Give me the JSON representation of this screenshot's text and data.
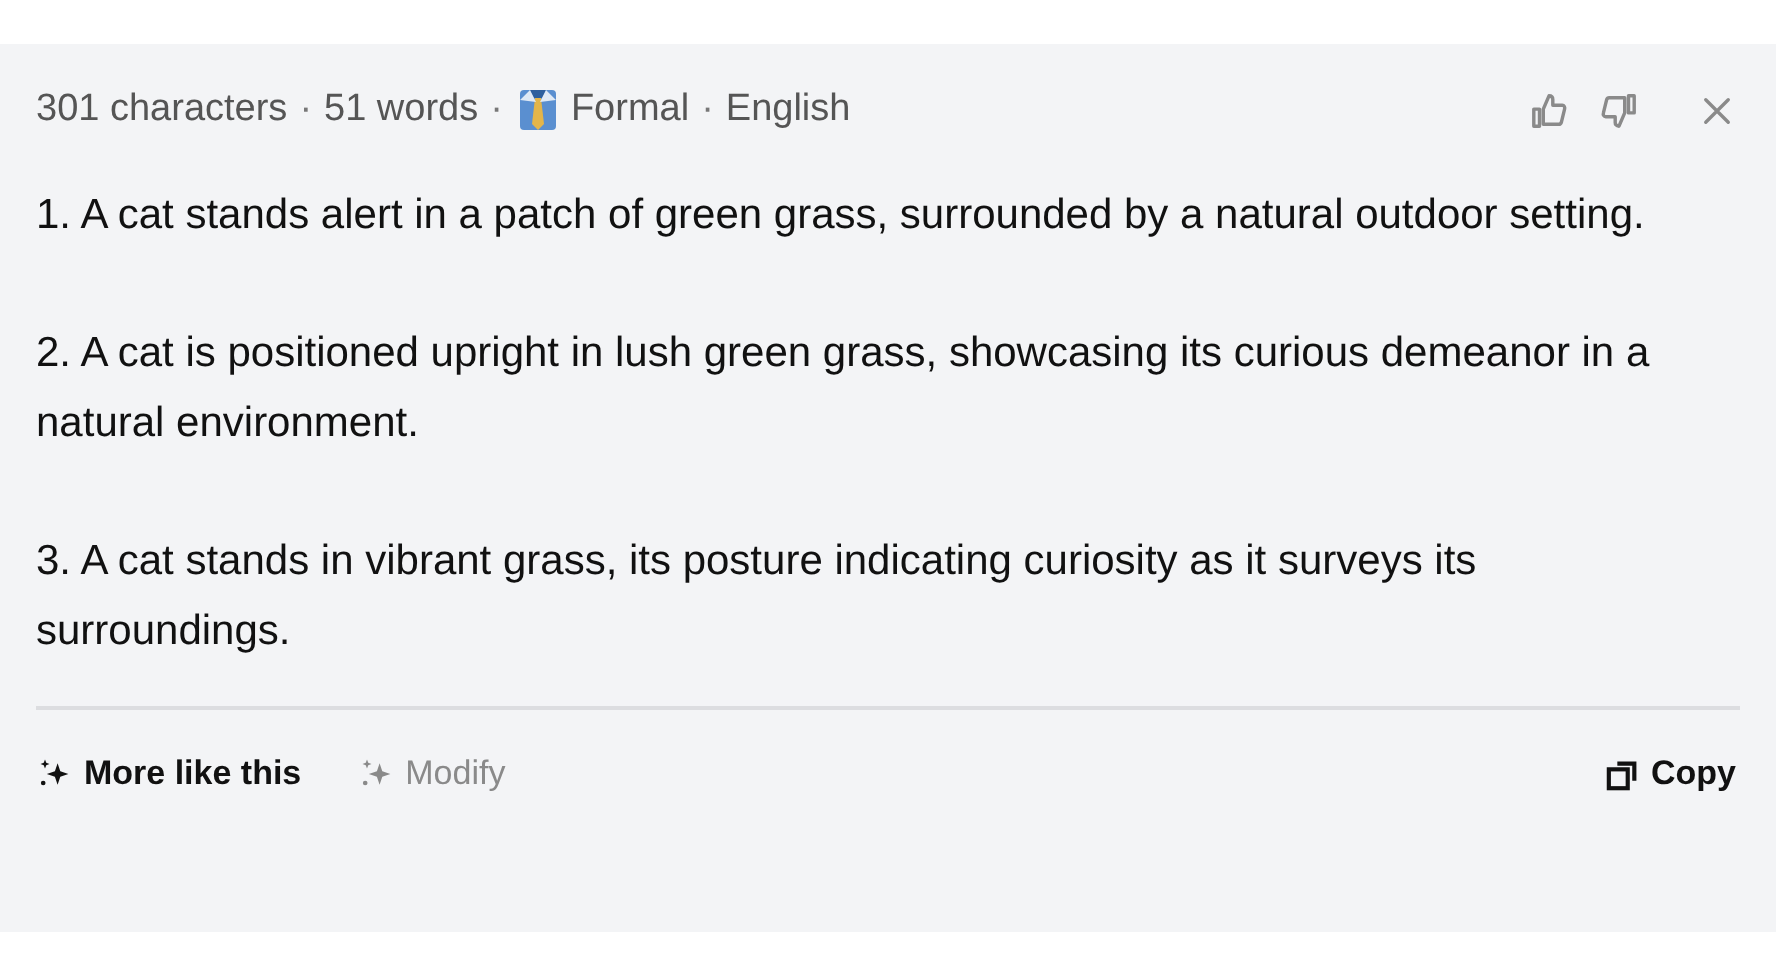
{
  "meta": {
    "characters": "301 characters",
    "sep_1": "·",
    "words": "51 words",
    "sep_2": "·",
    "tone": "Formal",
    "sep_3": "·",
    "language": "English"
  },
  "items": [
    "1. A cat stands alert in a patch of green grass, surrounded by a natural outdoor setting.",
    "2. A cat is positioned upright in lush green grass, showcasing its curious demeanor in a natural environment.",
    "3. A cat stands in vibrant grass, its posture indicating curiosity as it surveys its surroundings."
  ],
  "actions": [
    {
      "label": "More like this",
      "disabled": false
    },
    {
      "label": "Modify",
      "disabled": true
    }
  ],
  "copy": {
    "label": "Copy"
  }
}
